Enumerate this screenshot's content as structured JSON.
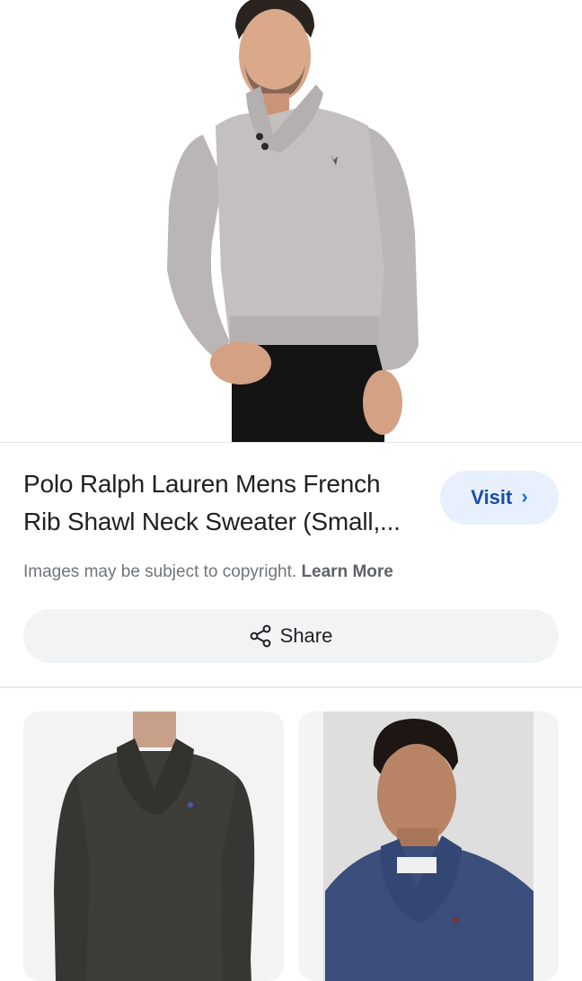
{
  "result": {
    "image_icon": "sweater-model-photo",
    "title": "Polo Ralph Lauren Mens French Rib Shawl Neck Sweater (Small,...",
    "visit_label": "Visit",
    "visit_icon": "chevron-right-icon"
  },
  "copyright": {
    "notice": "Images may be subject to copyright.",
    "learn_more": "Learn More"
  },
  "share": {
    "label": "Share",
    "icon": "share-icon"
  },
  "related": [
    {
      "icon": "charcoal-shawl-sweater-photo"
    },
    {
      "icon": "navy-shawl-sweater-photo"
    }
  ],
  "colors": {
    "visit_bg": "#e8f0fe",
    "visit_text": "#174ea6",
    "share_bg": "#f1f3f4",
    "muted_text": "#70757a"
  }
}
